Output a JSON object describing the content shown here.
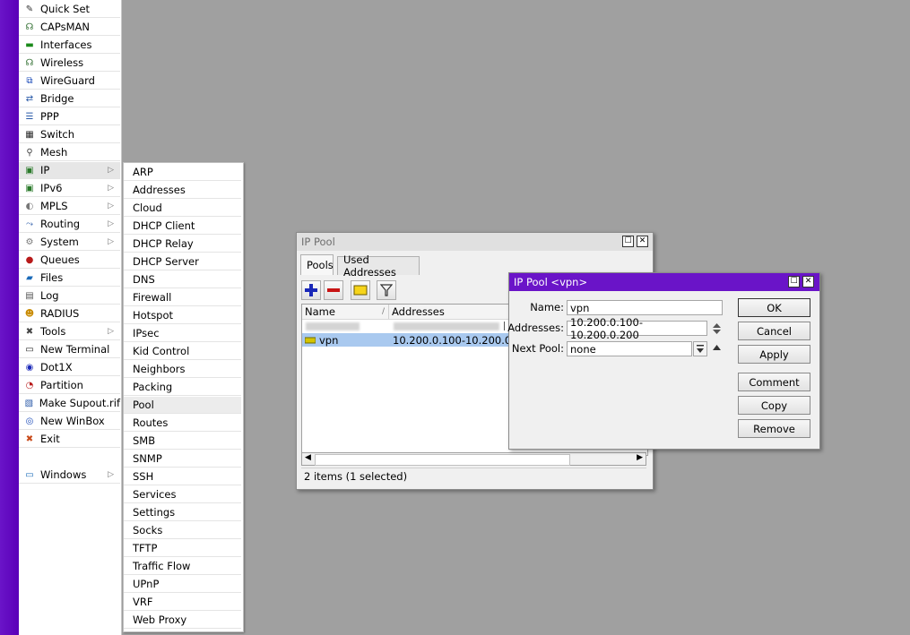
{
  "main_menu": {
    "items": [
      {
        "label": "Quick Set",
        "icon": "wand-icon"
      },
      {
        "label": "CAPsMAN",
        "icon": "antenna-icon"
      },
      {
        "label": "Interfaces",
        "icon": "interfaces-icon"
      },
      {
        "label": "Wireless",
        "icon": "antenna-icon"
      },
      {
        "label": "WireGuard",
        "icon": "wireguard-icon"
      },
      {
        "label": "Bridge",
        "icon": "bridge-icon"
      },
      {
        "label": "PPP",
        "icon": "ppp-icon"
      },
      {
        "label": "Switch",
        "icon": "switch-icon"
      },
      {
        "label": "Mesh",
        "icon": "mesh-icon"
      },
      {
        "label": "IP",
        "icon": "ip-icon",
        "arrow": "▷"
      },
      {
        "label": "IPv6",
        "icon": "ipv6-icon",
        "arrow": "▷"
      },
      {
        "label": "MPLS",
        "icon": "mpls-icon",
        "arrow": "▷"
      },
      {
        "label": "Routing",
        "icon": "routing-icon",
        "arrow": "▷"
      },
      {
        "label": "System",
        "icon": "gear-icon",
        "arrow": "▷"
      },
      {
        "label": "Queues",
        "icon": "queues-icon"
      },
      {
        "label": "Files",
        "icon": "folder-icon"
      },
      {
        "label": "Log",
        "icon": "log-icon"
      },
      {
        "label": "RADIUS",
        "icon": "users-icon"
      },
      {
        "label": "Tools",
        "icon": "tools-icon",
        "arrow": "▷"
      },
      {
        "label": "New Terminal",
        "icon": "terminal-icon"
      },
      {
        "label": "Dot1X",
        "icon": "dot1x-icon"
      },
      {
        "label": "Partition",
        "icon": "partition-icon"
      },
      {
        "label": "Make Supout.rif",
        "icon": "supout-icon"
      },
      {
        "label": "New WinBox",
        "icon": "winbox-icon"
      },
      {
        "label": "Exit",
        "icon": "exit-icon"
      },
      {
        "label": "Windows",
        "icon": "windows-icon",
        "arrow": "▷"
      }
    ]
  },
  "ip_submenu": {
    "items": [
      "ARP",
      "Addresses",
      "Cloud",
      "DHCP Client",
      "DHCP Relay",
      "DHCP Server",
      "DNS",
      "Firewall",
      "Hotspot",
      "IPsec",
      "Kid Control",
      "Neighbors",
      "Packing",
      "Pool",
      "Routes",
      "SMB",
      "SNMP",
      "SSH",
      "Services",
      "Settings",
      "Socks",
      "TFTP",
      "Traffic Flow",
      "UPnP",
      "VRF",
      "Web Proxy"
    ],
    "selected": "Pool"
  },
  "ip_pool_window": {
    "title": "IP Pool",
    "tabs": [
      "Pools",
      "Used Addresses"
    ],
    "active_tab": "Pools",
    "columns": [
      "Name",
      "Addresses"
    ],
    "rows": [
      {
        "name": "vpn",
        "addresses": "10.200.0.100-10.200.0.200",
        "selected": true
      }
    ],
    "status": "2 items (1 selected)",
    "buttons": {
      "restore": "☐",
      "close": "✕"
    }
  },
  "vpn_dialog": {
    "title": "IP Pool <vpn>",
    "name_label": "Name:",
    "name_value": "vpn",
    "addresses_label": "Addresses:",
    "addresses_value": "10.200.0.100-10.200.0.200",
    "next_pool_label": "Next Pool:",
    "next_pool_value": "none",
    "buttons": [
      "OK",
      "Cancel",
      "Apply",
      "Comment",
      "Copy",
      "Remove"
    ]
  },
  "colors": {
    "accent_purple": "#6a14c8",
    "selection_blue": "#a9c9ef",
    "desktop_gray": "#a0a0a0"
  }
}
